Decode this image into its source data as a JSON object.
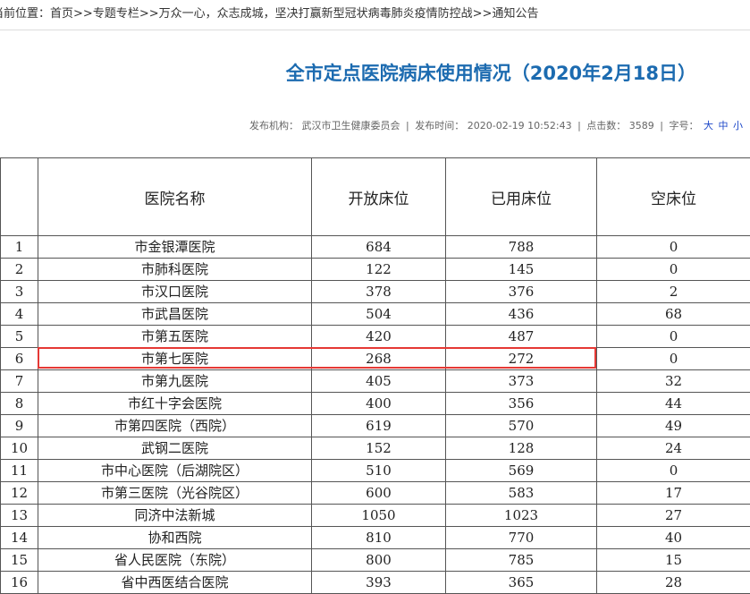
{
  "breadcrumb": {
    "prefix": "当前位置：",
    "items": [
      "首页",
      "专题专栏",
      "万众一心，众志成城，坚决打赢新型冠状病毒肺炎疫情防控战",
      "通知公告"
    ],
    "separator": ">>"
  },
  "article": {
    "title": "全市定点医院病床使用情况（2020年2月18日）",
    "publisher_label": "发布机构：",
    "publisher": "武汉市卫生健康委员会",
    "time_label": "发布时间：",
    "time": "2020-02-19 10:52:43",
    "views_label": "点击数：",
    "views": "3589",
    "fontsize_label": "字号：",
    "fontsize_options": [
      "大",
      "中",
      "小"
    ]
  },
  "table": {
    "headers": [
      "",
      "医院名称",
      "开放床位",
      "已用床位",
      "空床位"
    ],
    "rows": [
      [
        "1",
        "市金银潭医院",
        "684",
        "788",
        "0"
      ],
      [
        "2",
        "市肺科医院",
        "122",
        "145",
        "0"
      ],
      [
        "3",
        "市汉口医院",
        "378",
        "376",
        "2"
      ],
      [
        "4",
        "市武昌医院",
        "504",
        "436",
        "68"
      ],
      [
        "5",
        "市第五医院",
        "420",
        "487",
        "0"
      ],
      [
        "6",
        "市第七医院",
        "268",
        "272",
        "0"
      ],
      [
        "7",
        "市第九医院",
        "405",
        "373",
        "32"
      ],
      [
        "8",
        "市红十字会医院",
        "400",
        "356",
        "44"
      ],
      [
        "9",
        "市第四医院（西院）",
        "619",
        "570",
        "49"
      ],
      [
        "10",
        "武钢二医院",
        "152",
        "128",
        "24"
      ],
      [
        "11",
        "市中心医院（后湖院区）",
        "510",
        "569",
        "0"
      ],
      [
        "12",
        "市第三医院（光谷院区）",
        "600",
        "583",
        "17"
      ],
      [
        "13",
        "同济中法新城",
        "1050",
        "1023",
        "27"
      ],
      [
        "14",
        "协和西院",
        "810",
        "770",
        "40"
      ],
      [
        "15",
        "省人民医院（东院）",
        "800",
        "785",
        "15"
      ],
      [
        "16",
        "省中西医结合医院",
        "393",
        "365",
        "28"
      ]
    ],
    "highlight_color": "#e53935"
  }
}
